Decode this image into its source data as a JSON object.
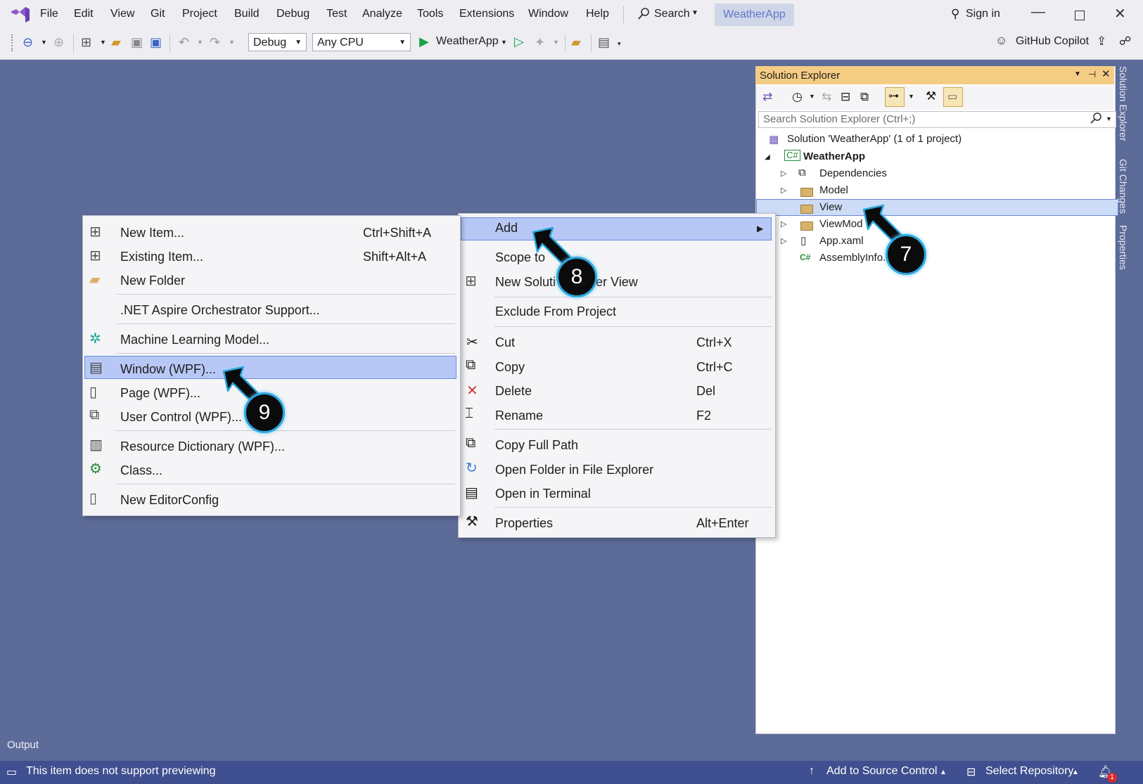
{
  "titlebar": {
    "menu": [
      "File",
      "Edit",
      "View",
      "Git",
      "Project",
      "Build",
      "Debug",
      "Test",
      "Analyze",
      "Tools",
      "Extensions",
      "Window",
      "Help"
    ],
    "search_label": "Search",
    "app_name": "WeatherApp",
    "sign_in": "Sign in"
  },
  "toolbar": {
    "config": "Debug",
    "platform": "Any CPU",
    "run_target": "WeatherApp",
    "copilot": "GitHub Copilot"
  },
  "solution_explorer": {
    "title": "Solution Explorer",
    "search_placeholder": "Search Solution Explorer (Ctrl+;)",
    "solution": "Solution 'WeatherApp' (1 of 1 project)",
    "project": "WeatherApp",
    "items": [
      "Dependencies",
      "Model",
      "View",
      "ViewMod",
      "App.xaml",
      "AssemblyInfo."
    ],
    "selected": "View"
  },
  "side_tabs": [
    "Solution Explorer",
    "Git Changes",
    "Properties"
  ],
  "context_menu": {
    "add": "Add",
    "scope_to": "Scope to",
    "new_view": "New Solution Explorer View",
    "new_view_visible_a": "New Soluti",
    "new_view_visible_b": "plorer View",
    "exclude": "Exclude From Project",
    "cut": "Cut",
    "cut_sc": "Ctrl+X",
    "copy": "Copy",
    "copy_sc": "Ctrl+C",
    "delete": "Delete",
    "delete_sc": "Del",
    "rename": "Rename",
    "rename_sc": "F2",
    "copy_full_path": "Copy Full Path",
    "open_folder": "Open Folder in File Explorer",
    "open_terminal": "Open in Terminal",
    "properties": "Properties",
    "properties_sc": "Alt+Enter"
  },
  "add_submenu": {
    "new_item": "New Item...",
    "new_item_sc": "Ctrl+Shift+A",
    "existing_item": "Existing Item...",
    "existing_item_sc": "Shift+Alt+A",
    "new_folder": "New Folder",
    "aspire": ".NET Aspire Orchestrator Support...",
    "ml_model": "Machine Learning Model...",
    "window_wpf": "Window (WPF)...",
    "page_wpf": "Page (WPF)...",
    "user_control": "User Control (WPF)...",
    "resource_dict": "Resource Dictionary (WPF)...",
    "class": "Class...",
    "editorconfig": "New EditorConfig"
  },
  "callouts": [
    "7",
    "8",
    "9"
  ],
  "output_label": "Output",
  "statusbar": {
    "message": "This item does not support previewing",
    "add_source_control": "Add to Source Control",
    "select_repo": "Select Repository",
    "notifications": "1"
  },
  "colors": {
    "workspace": "#5d6b99",
    "statusbar": "#3f4f8f",
    "panel_header": "#f5cc84",
    "highlight": "#b8c8f6",
    "callout_border": "#2aa8e0"
  }
}
